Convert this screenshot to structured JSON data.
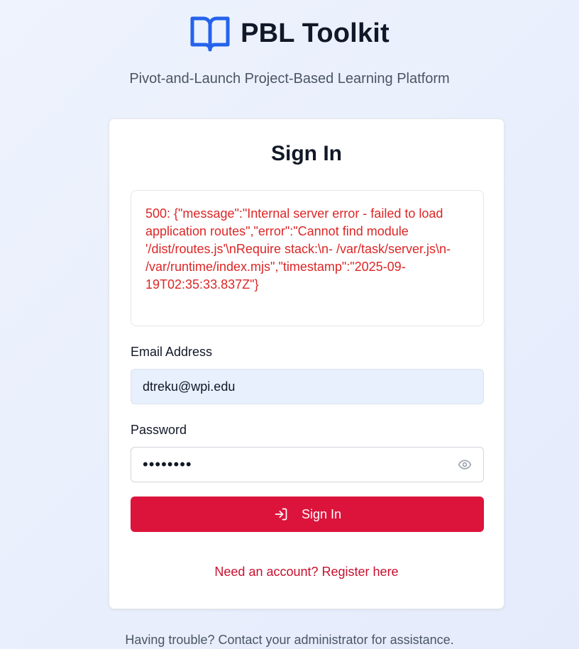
{
  "brand": {
    "title": "PBL Toolkit",
    "icon": "book-open-icon",
    "icon_color": "#2563eb"
  },
  "subtitle": "Pivot-and-Launch Project-Based Learning Platform",
  "card": {
    "title": "Sign In",
    "error_message": "500: {\"message\":\"Internal server error - failed to load application routes\",\"error\":\"Cannot find module '/dist/routes.js'\\nRequire stack:\\n- /var/task/server.js\\n- /var/runtime/index.mjs\",\"timestamp\":\"2025-09-19T02:35:33.837Z\"}",
    "error_color": "#dc2626",
    "email": {
      "label": "Email Address",
      "value": "dtreku@wpi.edu"
    },
    "password": {
      "label": "Password",
      "value": "••••••••",
      "toggle_icon": "eye-icon"
    },
    "submit": {
      "label": "Sign In",
      "icon": "log-in-icon",
      "color": "#dc143c"
    },
    "register_link": "Need an account? Register here"
  },
  "footer": {
    "note": "Having trouble? Contact your administrator for assistance."
  }
}
